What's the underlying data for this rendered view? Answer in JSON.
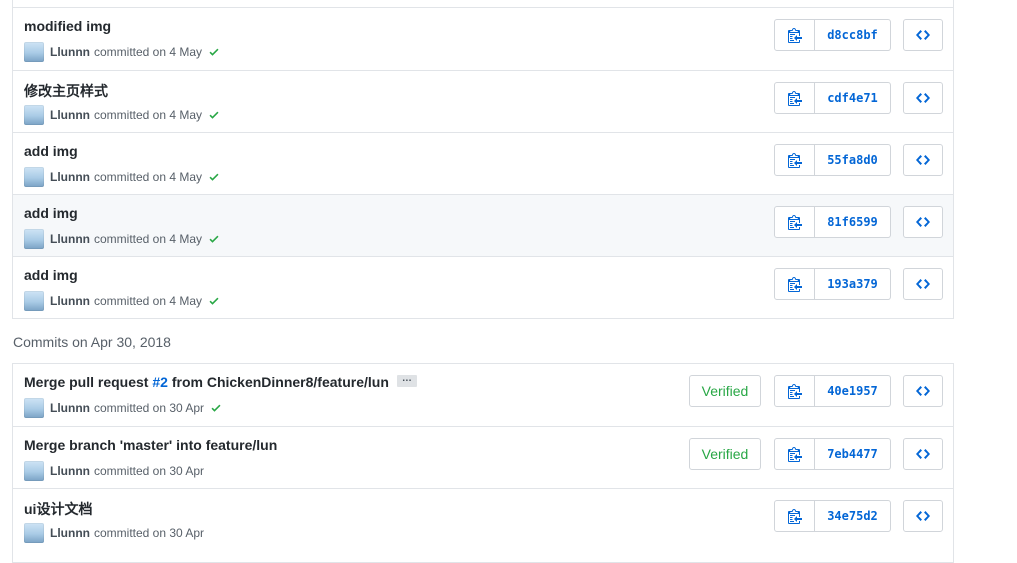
{
  "section1": {
    "commits": [
      {
        "message": "modified img",
        "author": "Llunnn",
        "committed": "committed on 4 May",
        "sha": "d8cc8bf",
        "status": "success"
      },
      {
        "message": "修改主页样式",
        "author": "Llunnn",
        "committed": "committed on 4 May",
        "sha": "cdf4e71",
        "status": "success"
      },
      {
        "message": "add img",
        "author": "Llunnn",
        "committed": "committed on 4 May",
        "sha": "55fa8d0",
        "status": "success"
      },
      {
        "message": "add img",
        "author": "Llunnn",
        "committed": "committed on 4 May",
        "sha": "81f6599",
        "status": "success"
      },
      {
        "message": "add img",
        "author": "Llunnn",
        "committed": "committed on 4 May",
        "sha": "193a379",
        "status": "success"
      }
    ]
  },
  "section2": {
    "heading": "Commits on Apr 30, 2018",
    "commits": [
      {
        "message_before": "Merge pull request ",
        "pr_link": "#2",
        "message_after": " from ChickenDinner8/feature/lun",
        "ellipsis": "…",
        "author": "Llunnn",
        "committed": "committed on 30 Apr",
        "sha": "40e1957",
        "verified": "Verified",
        "status": "success"
      },
      {
        "message": "Merge branch 'master' into feature/lun",
        "author": "Llunnn",
        "committed": "committed on 30 Apr",
        "sha": "7eb4477",
        "verified": "Verified"
      },
      {
        "message": "ui设计文档",
        "author": "Llunnn",
        "committed": "committed on 30 Apr",
        "sha": "34e75d2"
      }
    ]
  },
  "colors": {
    "link": "#0366d6",
    "success": "#28a745",
    "border": "#e1e4e8",
    "hover_row": "#f6f8fa"
  },
  "icons": {
    "copy": "clipboard-icon",
    "browse": "code-icon",
    "status": "check-icon",
    "avatar": "avatar"
  }
}
